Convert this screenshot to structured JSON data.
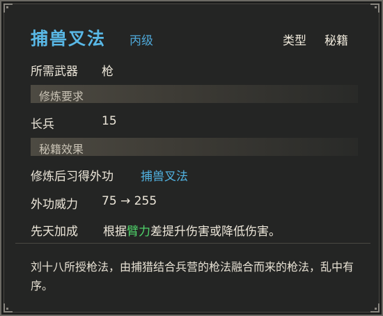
{
  "skill": {
    "name": "捕兽叉法",
    "grade": "丙级",
    "type_label": "类型",
    "type_value": "秘籍"
  },
  "weapon": {
    "label": "所需武器",
    "value": "枪"
  },
  "requirements": {
    "header": "修炼要求",
    "items": [
      {
        "label": "长兵",
        "value": "15"
      }
    ]
  },
  "effects": {
    "header": "秘籍效果",
    "learn": {
      "label": "修炼后习得外功",
      "value": "捕兽叉法"
    },
    "power": {
      "label": "外功威力",
      "value": "75 → 255"
    },
    "innate": {
      "label": "先天加成",
      "text_before": "根据",
      "attribute": "臂力",
      "text_after": "差提升伤害或降低伤害。"
    }
  },
  "description": "刘十八所授枪法，由捕猎结合兵营的枪法融合而来的枪法，乱中有序。",
  "colors": {
    "title": "#59b8e6",
    "highlight_blue": "#52b3e2",
    "highlight_green": "#4fd36a",
    "background": "#242524"
  }
}
